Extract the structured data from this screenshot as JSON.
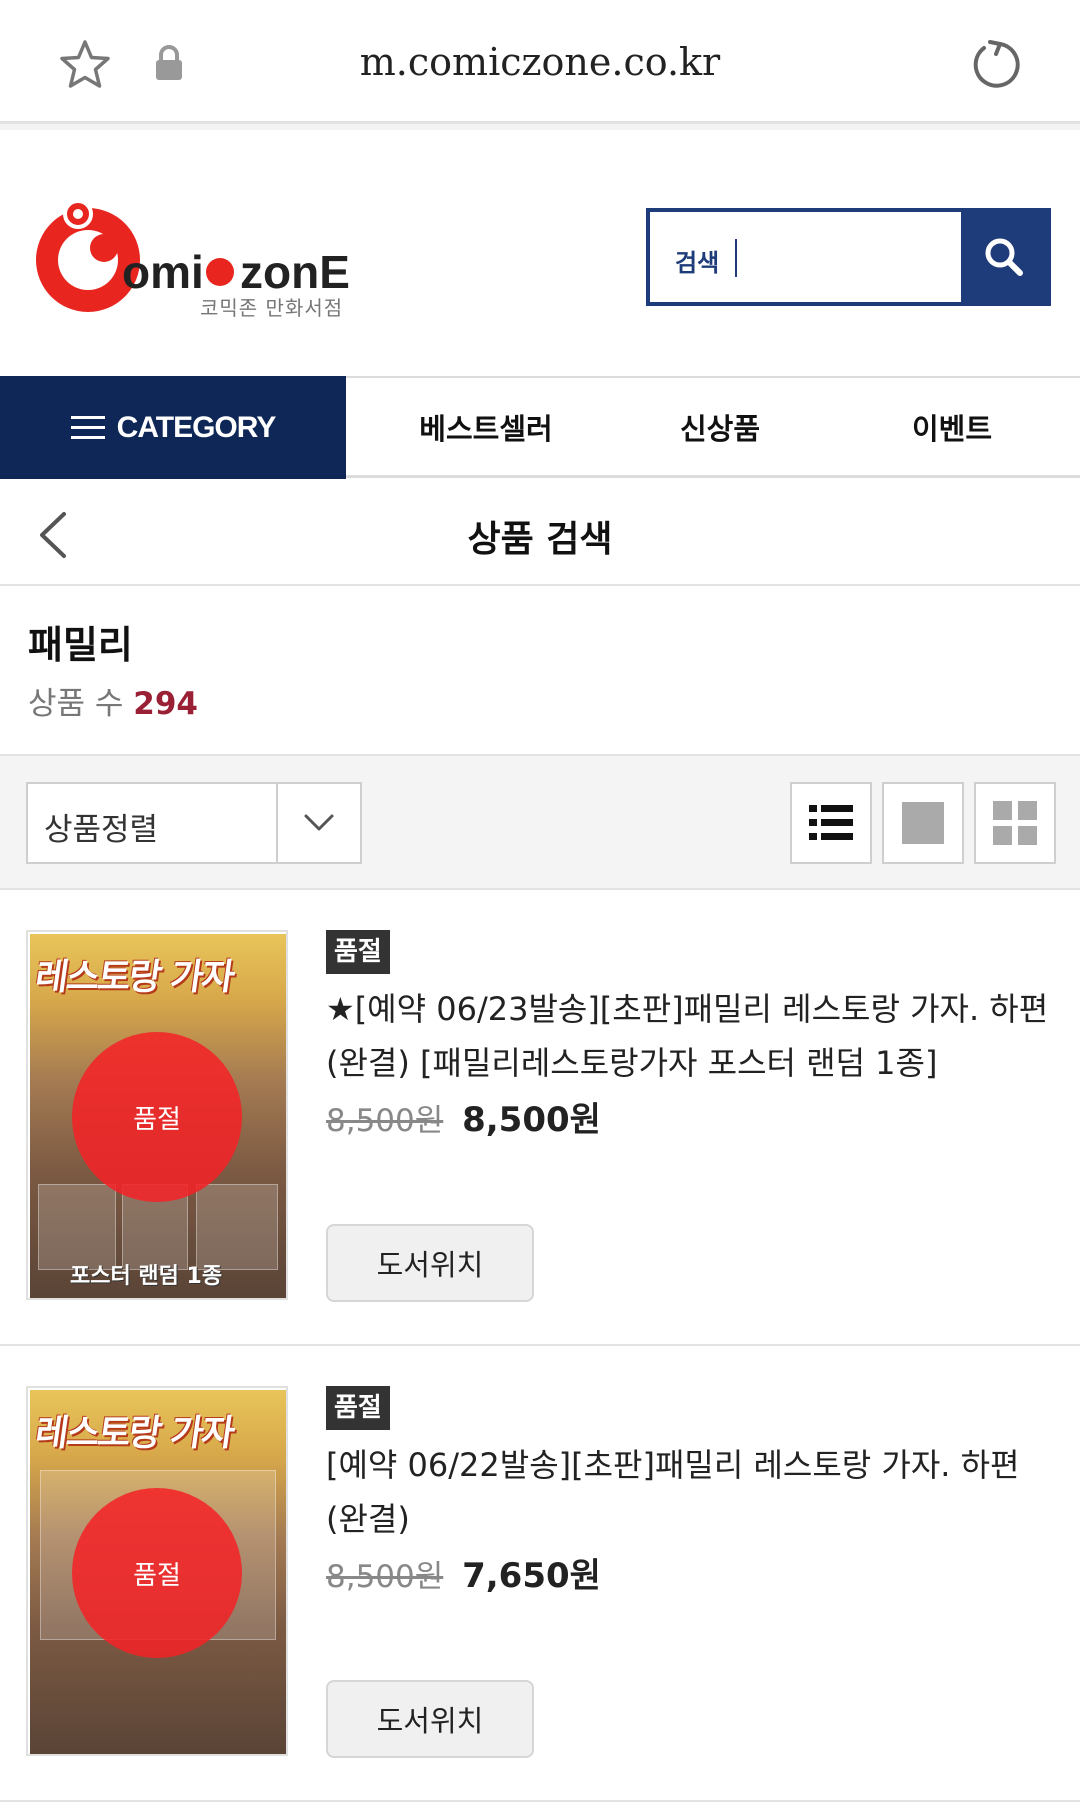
{
  "browser": {
    "url": "m.comiczone.co.kr"
  },
  "header": {
    "logo_text": "ComicZone",
    "logo_sub": "코믹존 만화서점",
    "search_placeholder": "검색"
  },
  "nav": {
    "category_label": "CATEGORY",
    "items": [
      "베스트셀러",
      "신상품",
      "이벤트"
    ]
  },
  "page": {
    "title": "상품 검색"
  },
  "query": {
    "term": "패밀리",
    "count_label": "상품 수",
    "count": "294"
  },
  "toolbar": {
    "sort_label": "상품정렬"
  },
  "products": [
    {
      "badge": "품절",
      "name": "★[예약 06/23발송][초판]패밀리 레스토랑 가자. 하편 (완결) [패밀리레스토랑가자 포스터 랜덤 1종]",
      "original_price": "8,500원",
      "sale_price": "8,500원",
      "soldout_overlay": "품절",
      "location_button": "도서위치",
      "cover_title": "레스토랑 가자",
      "cover_caption": "포스터 랜덤 1종"
    },
    {
      "badge": "품절",
      "name": "[예약 06/22발송][초판]패밀리 레스토랑 가자. 하편 (완결)",
      "original_price": "8,500원",
      "sale_price": "7,650원",
      "soldout_overlay": "품절",
      "location_button": "도서위치",
      "cover_title": "레스토랑 가자",
      "cover_caption": ""
    }
  ],
  "colors": {
    "brand_navy": "#0e2756",
    "search_blue": "#1f3c7a",
    "count_red": "#9a2036",
    "soldout_red": "#f52226",
    "logo_red": "#e8261f"
  }
}
